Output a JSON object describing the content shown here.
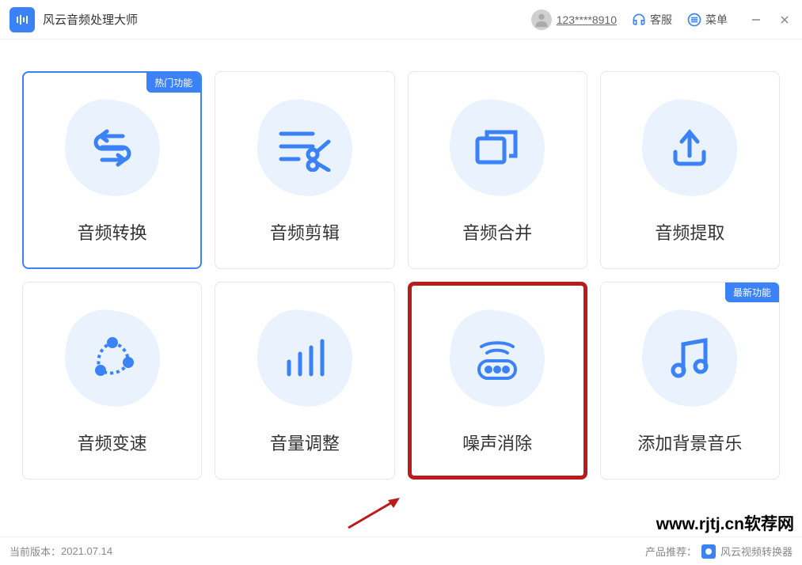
{
  "app": {
    "title": "风云音频处理大师"
  },
  "header": {
    "username": "123****8910",
    "support_label": "客服",
    "menu_label": "菜单"
  },
  "cards": [
    {
      "label": "音频转换",
      "badge": "热门功能",
      "icon": "convert"
    },
    {
      "label": "音频剪辑",
      "badge": null,
      "icon": "cut"
    },
    {
      "label": "音频合并",
      "badge": null,
      "icon": "merge"
    },
    {
      "label": "音频提取",
      "badge": null,
      "icon": "extract"
    },
    {
      "label": "音频变速",
      "badge": null,
      "icon": "speed"
    },
    {
      "label": "音量调整",
      "badge": null,
      "icon": "volume"
    },
    {
      "label": "噪声消除",
      "badge": null,
      "icon": "denoise"
    },
    {
      "label": "添加背景音乐",
      "badge": "最新功能",
      "icon": "bgm"
    }
  ],
  "footer": {
    "version_label": "当前版本：",
    "version": "2021.07.14",
    "recommend_label": "产品推荐：",
    "recommend_product": "风云视频转换器"
  },
  "watermark": "www.rjtj.cn软荐网"
}
